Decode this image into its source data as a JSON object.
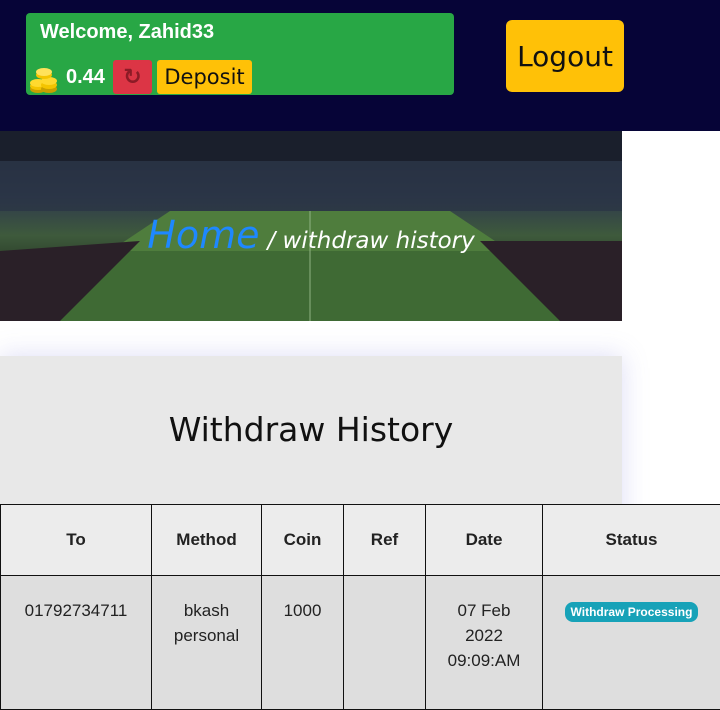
{
  "header": {
    "welcome": "Welcome, Zahid33",
    "balance": "0.44",
    "deposit_label": "Deposit",
    "logout_label": "Logout",
    "refresh_icon": "refresh-icon",
    "coin_icon": "coins-icon"
  },
  "banner": {
    "home_label": "Home",
    "crumb": "/ withdraw history"
  },
  "card": {
    "title": "Withdraw History"
  },
  "table": {
    "columns": [
      "To",
      "Method",
      "Coin",
      "Ref",
      "Date",
      "Status"
    ],
    "rows": [
      {
        "to": "01792734711",
        "method_line1": "bkash",
        "method_line2": "personal",
        "coin": "1000",
        "ref": "",
        "date_line1": "07 Feb",
        "date_line2": "2022",
        "date_line3": "09:09:AM",
        "status": "Withdraw Processing"
      }
    ]
  },
  "colors": {
    "header_bg": "#060437",
    "welcome_bg": "#28a745",
    "refresh_bg": "#dc3545",
    "deposit_bg": "#ffc107",
    "status_bg": "#17a2b8",
    "home_link": "#1e88ff"
  }
}
